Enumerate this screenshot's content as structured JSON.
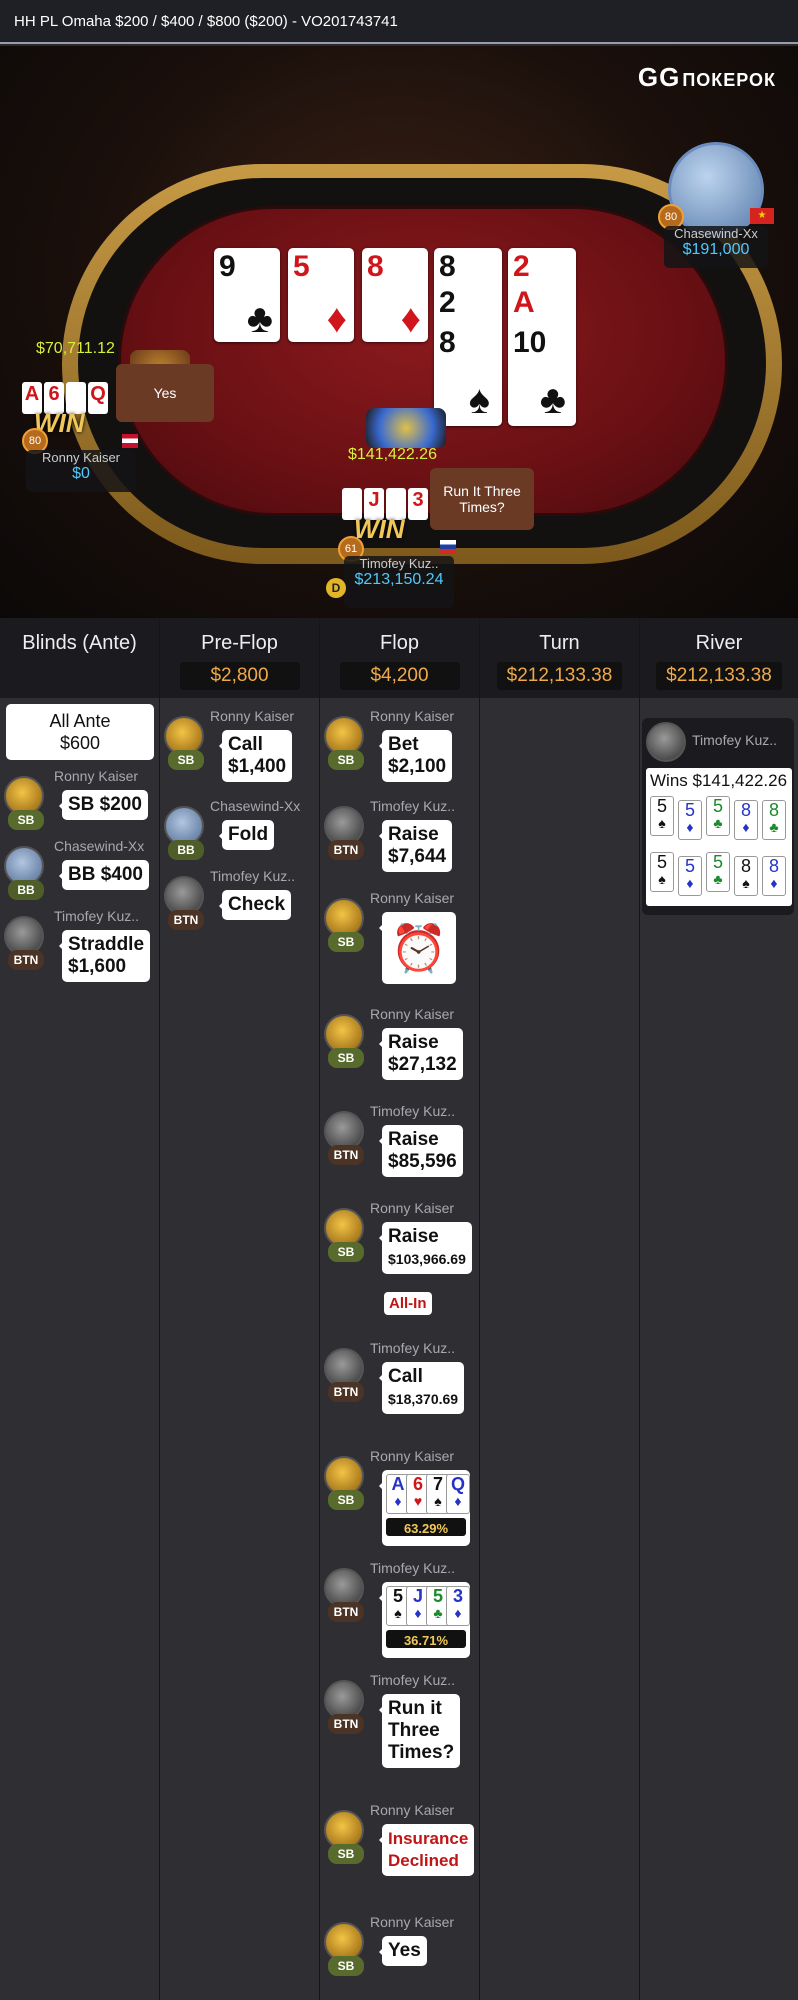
{
  "header": {
    "title": "HH PL Omaha $200 / $400 / $800 ($200)   - VO201743741"
  },
  "logo": {
    "text": "ПОКЕРОК",
    "mark": "GG"
  },
  "board": {
    "run1": [
      {
        "rank": "9",
        "suit": "♣",
        "color": "#111"
      },
      {
        "rank": "5",
        "suit": "♦",
        "color": "#d0151b"
      },
      {
        "rank": "8",
        "suit": "♦",
        "color": "#d0151b"
      },
      {
        "rank": "8",
        "suit": "♠",
        "color": "#111"
      },
      {
        "rank": "2",
        "suit": "♦",
        "color": "#d0151b"
      }
    ],
    "run2_turn": "2",
    "run2_river": "A",
    "run3_turn": "8",
    "run3_turn_suit": "♠",
    "run3_river": "10",
    "run3_river_suit": "♣"
  },
  "players": {
    "chasewind": {
      "name": "Chasewind-Xx",
      "stack": "$191,000",
      "level": "80"
    },
    "ronny": {
      "name": "Ronny Kaiser",
      "stack": "$0",
      "level": "80",
      "bet": "$70,711.12",
      "bubble": "Yes",
      "cards": [
        "A",
        "6",
        "7",
        "Q"
      ],
      "win": "WIN"
    },
    "timofey": {
      "name": "Timofey Kuz..",
      "stack": "$213,150.24",
      "level": "61",
      "bubble": "Run It Three Times?",
      "cards": [
        "5",
        "J",
        "5",
        "3"
      ],
      "win": "WIN"
    }
  },
  "pot": "$141,422.26",
  "columns": [
    {
      "title": "Blinds (Ante)",
      "pot": ""
    },
    {
      "title": "Pre-Flop",
      "pot": "$2,800"
    },
    {
      "title": "Flop",
      "pot": "$4,200"
    },
    {
      "title": "Turn",
      "pot": "$212,133.38"
    },
    {
      "title": "River",
      "pot": "$212,133.38"
    }
  ],
  "blinds": {
    "ante": "All Ante\n$600",
    "ante_l1": "All Ante",
    "ante_l2": "$600",
    "a1": {
      "name": "Ronny Kaiser",
      "pos": "SB",
      "text": "SB $200"
    },
    "a2": {
      "name": "Chasewind-Xx",
      "pos": "BB",
      "text": "BB $400"
    },
    "a3": {
      "name": "Timofey Kuz..",
      "pos": "BTN",
      "l1": "Straddle",
      "l2": "$1,600"
    }
  },
  "preflop": {
    "a1": {
      "name": "Ronny Kaiser",
      "pos": "SB",
      "l1": "Call",
      "l2": "$1,400"
    },
    "a2": {
      "name": "Chasewind-Xx",
      "pos": "BB",
      "l1": "Fold"
    },
    "a3": {
      "name": "Timofey Kuz..",
      "pos": "BTN",
      "l1": "Check"
    }
  },
  "flop": {
    "a1": {
      "name": "Ronny Kaiser",
      "pos": "SB",
      "l1": "Bet",
      "l2": "$2,100"
    },
    "a2": {
      "name": "Timofey Kuz..",
      "pos": "BTN",
      "l1": "Raise",
      "l2": "$7,644"
    },
    "a3": {
      "name": "Ronny Kaiser",
      "pos": "SB",
      "clock": "⏰"
    },
    "a4": {
      "name": "Ronny Kaiser",
      "pos": "SB",
      "l1": "Raise",
      "l2": "$27,132"
    },
    "a5": {
      "name": "Timofey Kuz..",
      "pos": "BTN",
      "l1": "Raise",
      "l2": "$85,596"
    },
    "a6": {
      "name": "Ronny Kaiser",
      "pos": "SB",
      "l1": "Raise",
      "l2": "$103,966.69",
      "allin": "All-In"
    },
    "a7": {
      "name": "Timofey Kuz..",
      "pos": "BTN",
      "l1": "Call",
      "l2": "$18,370.69"
    },
    "a8": {
      "name": "Ronny Kaiser",
      "pos": "SB",
      "cards": [
        "A",
        "6",
        "7",
        "Q"
      ],
      "equity": "63.29%"
    },
    "a9": {
      "name": "Timofey Kuz..",
      "pos": "BTN",
      "cards": [
        "5",
        "J",
        "5",
        "3"
      ],
      "equity": "36.71%"
    },
    "a10": {
      "name": "Timofey Kuz..",
      "pos": "BTN",
      "l1": "Run it",
      "l2": "Three",
      "l3": "Times?"
    },
    "a11": {
      "name": "Ronny Kaiser",
      "pos": "SB",
      "l1": "Insurance",
      "l2": "Declined"
    },
    "a12": {
      "name": "Ronny Kaiser",
      "pos": "SB",
      "l1": "Yes"
    }
  },
  "river": {
    "name": "Timofey Kuz..",
    "wins": "Wins $141,422.26",
    "row1": [
      "5",
      "5",
      "5",
      "8",
      "8"
    ],
    "row2": [
      "5",
      "5",
      "5",
      "8",
      "8"
    ]
  }
}
